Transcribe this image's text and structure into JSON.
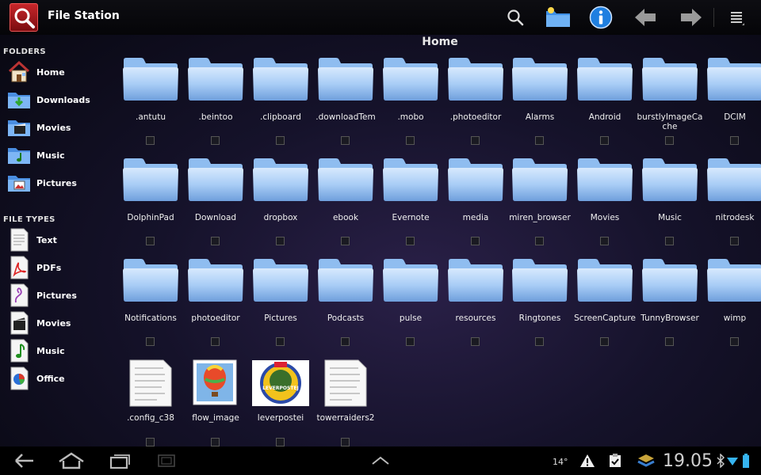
{
  "app": {
    "title": "File Station"
  },
  "toolbar": {
    "search_icon": "search-icon",
    "new_folder_icon": "new-folder-icon",
    "info_icon": "info-icon",
    "back_icon": "arrow-left-icon",
    "forward_icon": "arrow-right-icon",
    "menu_icon": "menu-icon"
  },
  "sidebar": {
    "folders_title": "FOLDERS",
    "folders": [
      {
        "label": "Home",
        "icon": "home-icon"
      },
      {
        "label": "Downloads",
        "icon": "downloads-folder-icon"
      },
      {
        "label": "Movies",
        "icon": "movies-folder-icon"
      },
      {
        "label": "Music",
        "icon": "music-folder-icon"
      },
      {
        "label": "Pictures",
        "icon": "pictures-folder-icon"
      }
    ],
    "filetypes_title": "FILE TYPES",
    "filetypes": [
      {
        "label": "Text",
        "icon": "text-file-icon"
      },
      {
        "label": "PDFs",
        "icon": "pdf-icon"
      },
      {
        "label": "Pictures",
        "icon": "picture-file-icon"
      },
      {
        "label": "Movies",
        "icon": "clapperboard-icon"
      },
      {
        "label": "Music",
        "icon": "music-note-icon"
      },
      {
        "label": "Office",
        "icon": "office-icon"
      }
    ]
  },
  "main": {
    "title": "Home",
    "folders": [
      ".antutu",
      ".beintoo",
      ".clipboard",
      ".downloadTem",
      ".mobo",
      ".photoeditor",
      "Alarms",
      "Android",
      "burstlyImageCache",
      "DCIM",
      "DolphinPad",
      "Download",
      "dropbox",
      "ebook",
      "Evernote",
      "media",
      "miren_browser",
      "Movies",
      "Music",
      "nitrodesk",
      "Notifications",
      "photoeditor",
      "Pictures",
      "Podcasts",
      "pulse",
      "resources",
      "Ringtones",
      "ScreenCapture",
      "TunnyBrowser",
      "wimp"
    ],
    "files": [
      {
        "name": ".config_c38",
        "kind": "text-document"
      },
      {
        "name": "flow_image",
        "kind": "balloon-image"
      },
      {
        "name": "leverpostei",
        "kind": "label-image"
      },
      {
        "name": "towerraiders2",
        "kind": "text-document"
      }
    ],
    "label_image_text": "LEVERPOSTEJ"
  },
  "statusbar": {
    "temperature": "14°",
    "clock": "19.05"
  },
  "colors": {
    "folder_light": "#cfe3fb",
    "folder_dark": "#6b9fe0",
    "accent_blue": "#1f7fe0",
    "app_red": "#b81d22"
  }
}
